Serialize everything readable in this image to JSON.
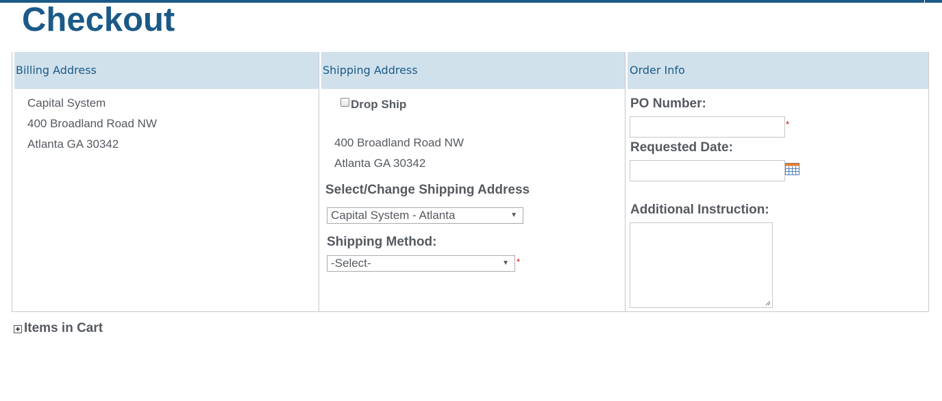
{
  "page": {
    "title": "Checkout"
  },
  "billing": {
    "header": "Billing Address",
    "lines": [
      "Capital System",
      "400 Broadland Road NW",
      "Atlanta GA 30342"
    ]
  },
  "shipping": {
    "header": "Shipping Address",
    "drop_ship_label": "Drop Ship",
    "drop_ship_checked": false,
    "address_lines": [
      "400 Broadland Road NW",
      "Atlanta GA 30342"
    ],
    "select_address_label": "Select/Change Shipping Address",
    "selected_address": "Capital System - Atlanta",
    "method_label": "Shipping Method:",
    "selected_method": "-Select-",
    "required_mark": "*"
  },
  "order": {
    "header": "Order Info",
    "po_label": "PO Number:",
    "po_value": "",
    "required_mark": "*",
    "requested_date_label": "Requested Date:",
    "requested_date_value": "",
    "instruction_label": "Additional Instruction:",
    "instruction_value": ""
  },
  "cart": {
    "toggle_label": "Items in Cart"
  },
  "icons": {
    "calendar": "calendar-icon",
    "expand": "plus-box-icon",
    "dropdown": "triangle-down-icon",
    "resize": "resize-grip-icon"
  },
  "colors": {
    "brand_blue": "#1b5a87",
    "header_bg": "#d0e1ec",
    "text_gray": "#555a60",
    "required_red": "#d40000"
  }
}
